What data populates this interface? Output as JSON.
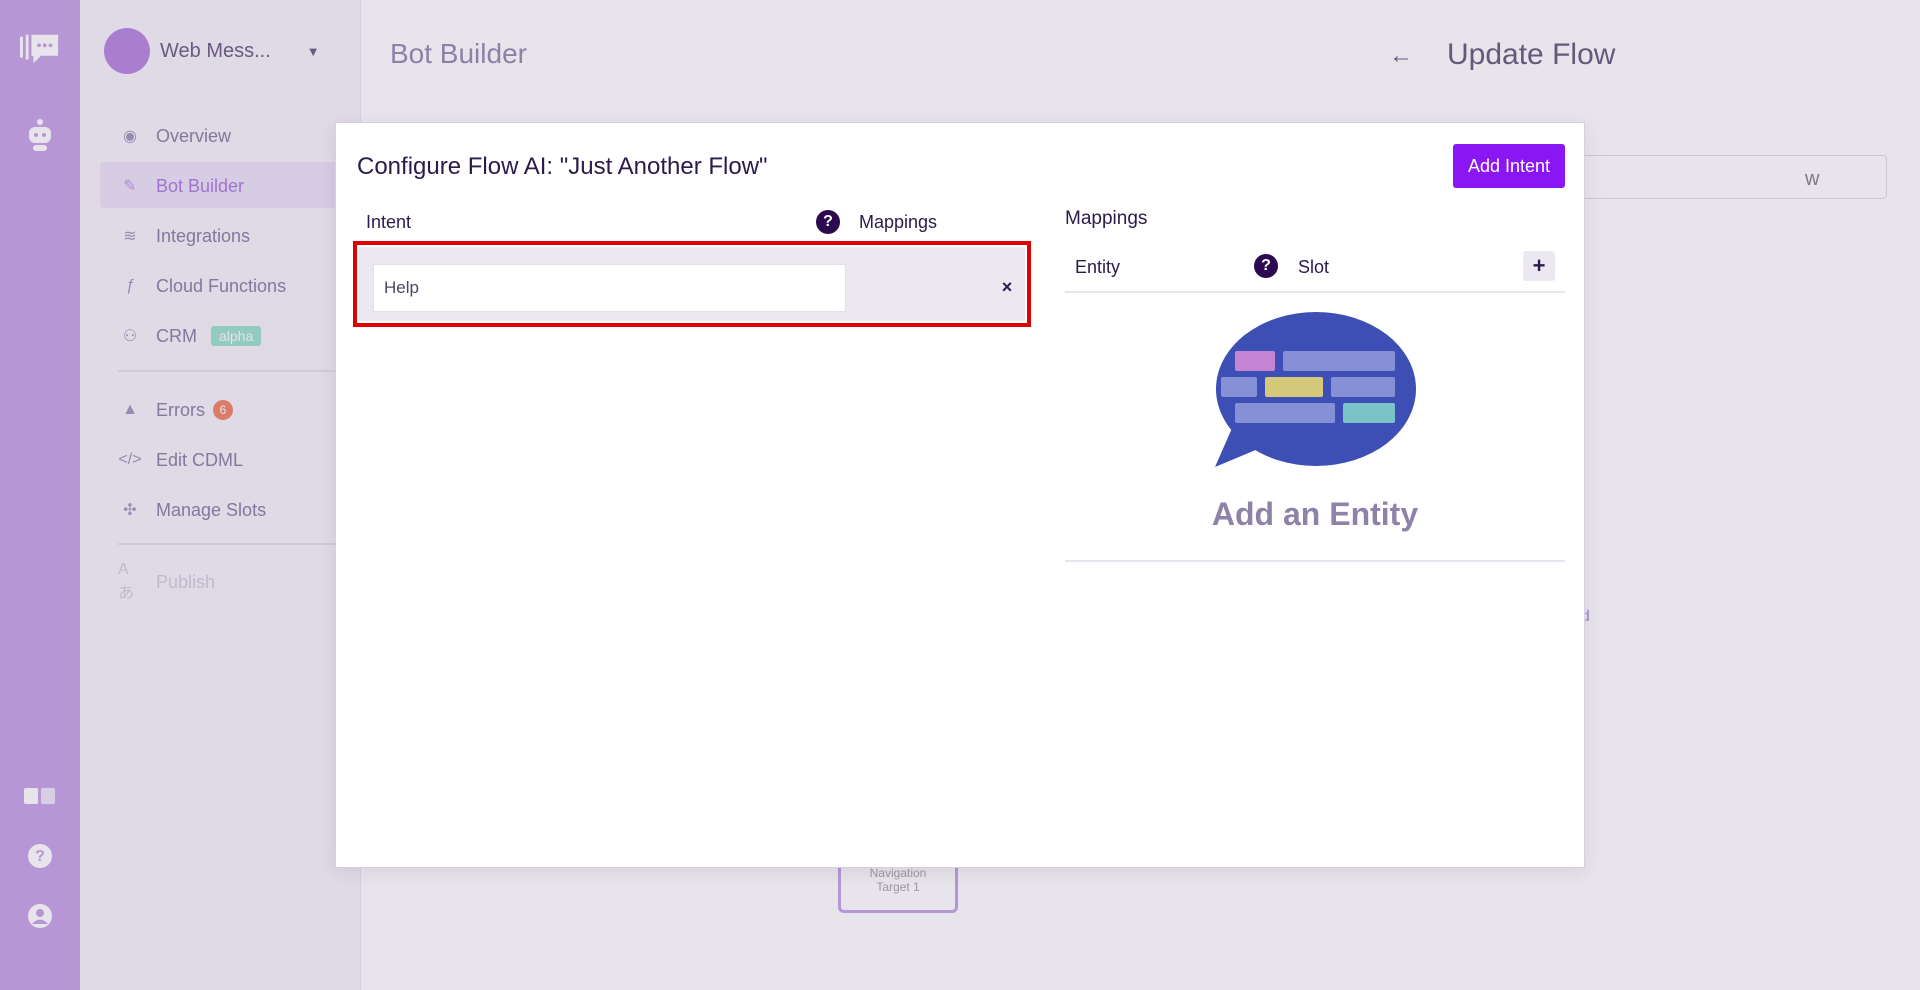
{
  "app": {
    "workspace_name": "Web Mess...",
    "main_title": "Bot Builder",
    "nav": [
      {
        "label": "Overview",
        "icon": "eye-icon"
      },
      {
        "label": "Bot Builder",
        "icon": "pencil-icon"
      },
      {
        "label": "Integrations",
        "icon": "layers-icon"
      },
      {
        "label": "Cloud Functions",
        "icon": "function-icon"
      },
      {
        "label": "CRM",
        "icon": "handshake-icon",
        "badge": "alpha"
      },
      {
        "label": "Errors",
        "icon": "warning-icon",
        "badge": "6"
      },
      {
        "label": "Edit CDML",
        "icon": "code-icon"
      },
      {
        "label": "Manage Slots",
        "icon": "puzzle-icon"
      },
      {
        "label": "Publish",
        "icon": "translate-icon"
      }
    ],
    "canvas_node": {
      "line1": "Navigation",
      "line2": "Target 1"
    }
  },
  "right_panel": {
    "back_icon": "arrow-left-icon",
    "title": "Update Flow",
    "name_value_fragment": "w",
    "link_fragment": "ad"
  },
  "modal": {
    "title": "Configure Flow AI: \"Just Another Flow\"",
    "add_intent_label": "Add Intent",
    "intent_column": "Intent",
    "mappings_column": "Mappings",
    "intents": [
      {
        "value": "Help"
      }
    ],
    "remove_symbol": "×",
    "mappings_title": "Mappings",
    "entity_column": "Entity",
    "slot_column": "Slot",
    "add_symbol": "+",
    "help_symbol": "?",
    "empty_state_label": "Add an Entity"
  },
  "colors": {
    "accent": "#8a16f3",
    "highlight": "#e00000",
    "illustration_bubble": "#3d4eb5"
  }
}
